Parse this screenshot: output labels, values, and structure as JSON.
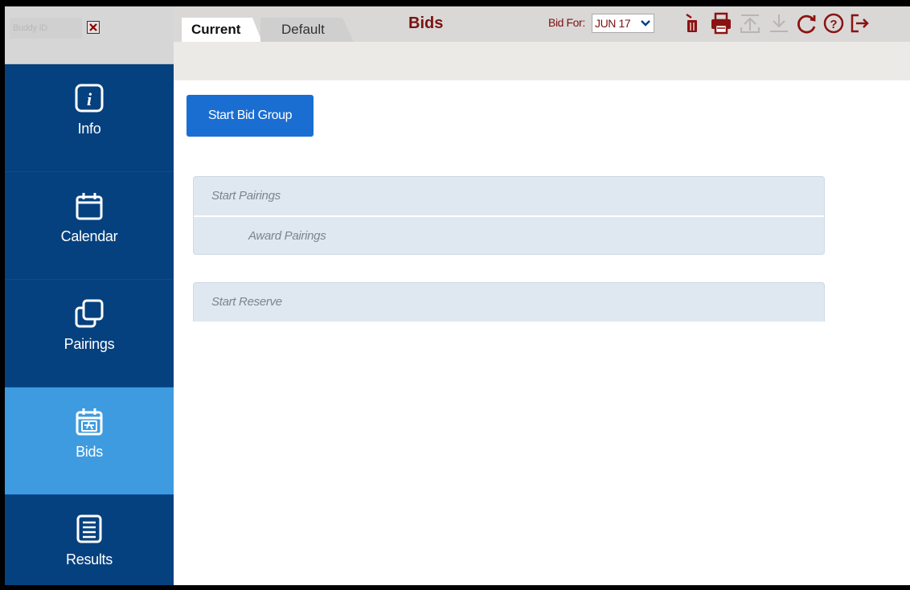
{
  "buddy": {
    "placeholder": "Buddy ID"
  },
  "tabs": [
    {
      "label": "Current",
      "active": true
    },
    {
      "label": "Default",
      "active": false
    }
  ],
  "header": {
    "title": "Bids",
    "bid_for_label": "Bid For:",
    "bid_for_value": "JUN 17"
  },
  "toolbar": {
    "icons": [
      "trash-icon",
      "print-icon",
      "upload-icon",
      "download-icon",
      "refresh-icon",
      "help-icon",
      "logout-icon"
    ]
  },
  "nav": {
    "items": [
      {
        "label": "Info",
        "icon": "info-icon",
        "active": false
      },
      {
        "label": "Calendar",
        "icon": "calendar-icon",
        "active": false
      },
      {
        "label": "Pairings",
        "icon": "pairings-icon",
        "active": false
      },
      {
        "label": "Bids",
        "icon": "bids-icon",
        "active": true
      },
      {
        "label": "Results",
        "icon": "results-icon",
        "active": false
      }
    ]
  },
  "main": {
    "start_bid_group_label": "Start Bid Group",
    "panels": [
      {
        "rows": [
          "Start Pairings",
          "Award Pairings"
        ]
      },
      {
        "rows": [
          "Start Reserve"
        ]
      }
    ]
  },
  "colors": {
    "sidebar_bg": "#06417f",
    "sidebar_active": "#3e9be0",
    "primary_button": "#1a6ed1",
    "title_red": "#7a1212",
    "panel_bg": "#dfe8f1"
  }
}
